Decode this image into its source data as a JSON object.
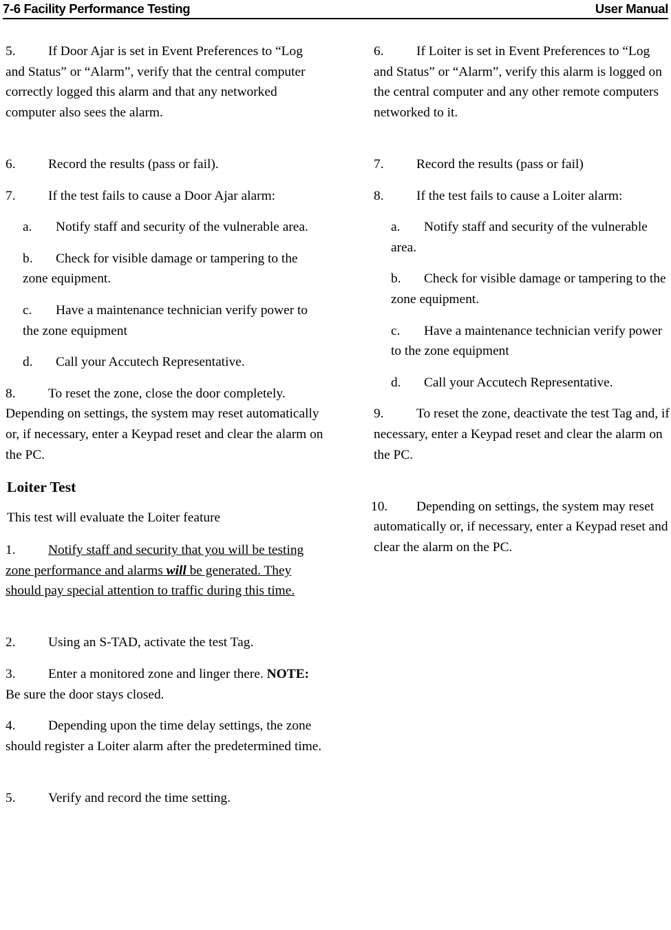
{
  "header": {
    "left": "7-6 Facility Performance Testing",
    "right": "User Manual"
  },
  "left_column": {
    "items": [
      {
        "marker": "5.",
        "text": "If Door Ajar is set in Event Preferences to “Log and Status” or “Alarm”, verify that the central computer correctly logged this alarm and that any networked computer also sees the alarm."
      },
      {
        "marker": "6.",
        "text": "Record the results (pass or fail)."
      },
      {
        "marker": "7.",
        "text": "If the test fails to cause a Door Ajar alarm:"
      },
      {
        "marker": "a.",
        "text": "Notify staff and security of the vulnerable area."
      },
      {
        "marker": "b.",
        "text": "Check for visible damage or tampering to the zone equipment."
      },
      {
        "marker": "c.",
        "text": "Have a maintenance technician verify power to the zone equipment"
      },
      {
        "marker": "d.",
        "text": "Call your Accutech Representative."
      },
      {
        "marker": "8.",
        "text": "To reset the zone, close the door completely. Depending on settings, the system may reset automatically or, if necessary, enter a Keypad reset and clear the alarm on the PC."
      }
    ],
    "heading": "Loiter Test",
    "lead_paragraph": "This test will evaluate the Loiter feature",
    "loiter_items": [
      {
        "marker": "1.",
        "text_before": "Notify staff and security that you will be testing zone performance and alarms ",
        "emphasis": "will",
        "text_after": " be generated. They should pay special attention to traffic during this time."
      },
      {
        "marker": "2.",
        "text": "Using an S-TAD, activate the test Tag."
      },
      {
        "marker": "3.",
        "text": "Enter a monitored zone and linger there. ",
        "note_label": "NOTE:",
        "note_text": " Be sure the door stays closed."
      },
      {
        "marker": "4.",
        "text": "Depending upon the time delay settings, the zone should register a Loiter alarm after the predetermined time."
      },
      {
        "marker": "5.",
        "text": "Verify and record the time setting."
      }
    ]
  },
  "right_column": {
    "items": [
      {
        "marker": "6.",
        "text": "If Loiter is set in Event Preferences to “Log and Status” or “Alarm”, verify this alarm is logged on the central computer and any other remote computers networked to it."
      },
      {
        "marker": "7.",
        "text": "Record the results (pass or fail)"
      },
      {
        "marker": "8.",
        "text": "If the test fails to cause a Loiter alarm:"
      },
      {
        "marker": "a.",
        "text": "Notify staff and security of the vulnerable area."
      },
      {
        "marker": "b.",
        "text": "Check for visible damage or tampering to the zone equipment."
      },
      {
        "marker": "c.",
        "text": "Have a maintenance technician verify power to the zone equipment"
      },
      {
        "marker": "d.",
        "text": "Call your Accutech Representative."
      },
      {
        "marker": "9.",
        "text": "To reset the zone, deactivate the test Tag and, if necessary, enter a Keypad reset and clear the alarm on the PC."
      },
      {
        "marker": "10.",
        "text": "Depending on settings, the system may reset automatically or, if necessary, enter a Keypad reset and clear the alarm on the PC."
      }
    ]
  }
}
